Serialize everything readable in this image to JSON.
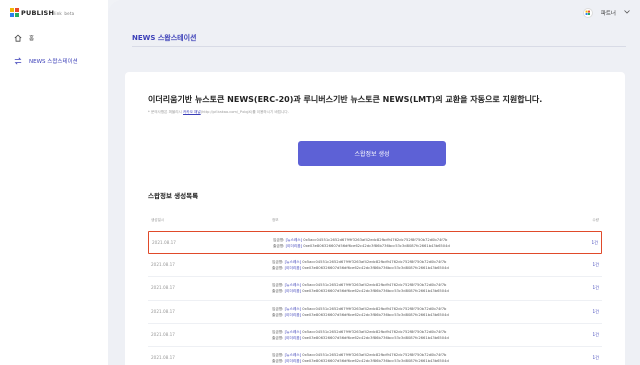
{
  "brand": {
    "name": "PUBLISH",
    "suffix": "link",
    "tag": "beta"
  },
  "sidebar": {
    "items": [
      {
        "label": "홈",
        "icon": "home-icon"
      },
      {
        "label": "NEWS 스왑스테이션",
        "icon": "swap-icon"
      }
    ]
  },
  "header": {
    "user": "파트너",
    "user_menu_icon": "chevron-down-icon"
  },
  "page": {
    "title": "NEWS 스왑스테이션"
  },
  "card": {
    "headline": "이더리움기반 뉴스토큰 NEWS(ERC-20)과 루니버스기반 뉴스토큰 NEWS(LMT)의 교환을 자동으로 지원합니다.",
    "note_prefix": "* 문의사항은 퍼블리시",
    "note_link": "카카오 채널",
    "note_suffix": "(http://pf.kakao.com/_PxlqjX)를 이용하시기 바랍니다.",
    "button_label": "스왑정보 생성",
    "section_title": "스왑정보 생성목록"
  },
  "table": {
    "headers": {
      "date": "생성일시",
      "info": "정보",
      "qty": "수량"
    },
    "rows": [
      {
        "date": "2021.08.17",
        "l1_label": "입금명:",
        "l1_tag": "[뉴스레스]",
        "l1_addr": "0x5acc04551c2652d6799f3263af42edc82fbd94762dc752f8f750b72d0b74f7b",
        "l2_label": "출금명:",
        "l2_tag": "[이더리움]",
        "l2_addr": "0xe03e806326607d56df6ce62c42dc3f86b736bcc53c3d8087fc2661b43b6504d",
        "qty": "1건"
      },
      {
        "date": "2021.08.17",
        "l1_label": "입금명:",
        "l1_tag": "[뉴스레스]",
        "l1_addr": "0x5acc04551c2652d6799f3263af42edc82fbd94762dc752f8f750b72d0b74f7b",
        "l2_label": "출금명:",
        "l2_tag": "[이더리움]",
        "l2_addr": "0xe03e806326607d56df6ce62c42dc3f86b736bcc53c3d8087fc2661b43b6504d",
        "qty": "1건"
      },
      {
        "date": "2021.08.17",
        "l1_label": "입금명:",
        "l1_tag": "[뉴스레스]",
        "l1_addr": "0x5acc04551c2652d6799f3263af42edc82fbd94762dc752f8f750b72d0b74f7b",
        "l2_label": "출금명:",
        "l2_tag": "[이더리움]",
        "l2_addr": "0xe03e806326607d56df6ce62c42dc3f86b736bcc53c3d8087fc2661b43b6504d",
        "qty": "1건"
      },
      {
        "date": "2021.08.17",
        "l1_label": "입금명:",
        "l1_tag": "[뉴스레스]",
        "l1_addr": "0x5acc04551c2652d6799f3263af42edc82fbd94762dc752f8f750b72d0b74f7b",
        "l2_label": "출금명:",
        "l2_tag": "[이더리움]",
        "l2_addr": "0xe03e806326607d56df6ce62c42dc3f86b736bcc53c3d8087fc2661b43b6504d",
        "qty": "1건"
      },
      {
        "date": "2021.08.17",
        "l1_label": "입금명:",
        "l1_tag": "[뉴스레스]",
        "l1_addr": "0x5acc04551c2652d6799f3263af42edc82fbd94762dc752f8f750b72d0b74f7b",
        "l2_label": "출금명:",
        "l2_tag": "[이더리움]",
        "l2_addr": "0xe03e806326607d56df6ce62c42dc3f86b736bcc53c3d8087fc2661b43b6504d",
        "qty": "1건"
      },
      {
        "date": "2021.08.17",
        "l1_label": "입금명:",
        "l1_tag": "[뉴스레스]",
        "l1_addr": "0x5acc04551c2652d6799f3263af42edc82fbd94762dc752f8f750b72d0b74f7b",
        "l2_label": "출금명:",
        "l2_tag": "[이더리움]",
        "l2_addr": "0xe03e806326607d56df6ce62c42dc3f86b736bcc53c3d8087fc2661b43b6504d",
        "qty": "1건"
      }
    ]
  },
  "colors": {
    "accent": "#5d61d6",
    "link": "#3b3fb8",
    "highlight": "#e04a2a",
    "background": "#eef0f5"
  }
}
